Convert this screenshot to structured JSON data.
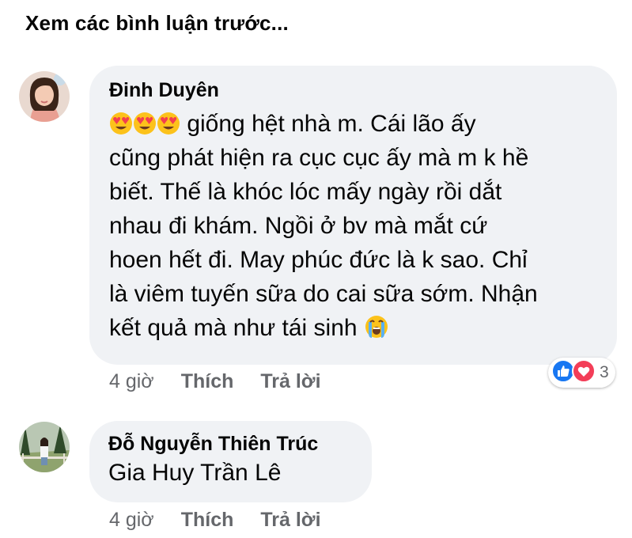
{
  "prev_comments_link": "Xem các bình luận trước...",
  "comments": [
    {
      "author": "Đinh Duyên",
      "leading_emojis": [
        "heart-eyes-emoji",
        "heart-eyes-emoji",
        "heart-eyes-emoji"
      ],
      "text_line1": " giống hệt nhà m. Cái lão ấy",
      "text_rest": "cũng phát hiện ra cục cục ấy mà m k hề\nbiết. Thế là khóc lóc mấy ngày rồi dắt\nnhau đi khám. Ngồi ở bv mà mắt cứ\nhoen hết đi. May phúc đức là k sao. Chỉ\nlà viêm tuyến sữa do cai sữa sớm. Nhận\nkết quả mà như tái sinh ",
      "trailing_emoji": "loudly-crying-emoji",
      "time": "4 giờ",
      "like_label": "Thích",
      "reply_label": "Trả lời",
      "reactions": {
        "types": [
          "like-icon",
          "love-icon"
        ],
        "count": "3"
      }
    },
    {
      "author": "Đỗ Nguyễn Thiên Trúc",
      "text": "Gia Huy Trần Lê",
      "time": "4 giờ",
      "like_label": "Thích",
      "reply_label": "Trả lời"
    }
  ],
  "colors": {
    "bubble": "#f0f2f5",
    "meta_text": "#65676b",
    "like_blue": "#1877f2",
    "love_red": "#f33e58"
  }
}
